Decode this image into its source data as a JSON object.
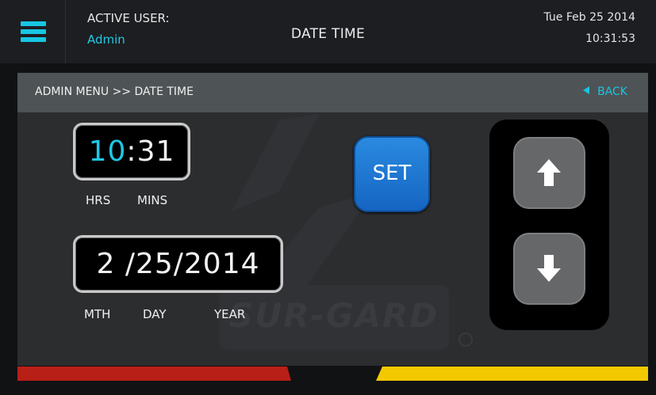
{
  "header": {
    "active_user_label": "ACTIVE USER:",
    "active_user_value": "Admin",
    "title": "DATE TIME",
    "date": "Tue Feb 25 2014",
    "time": "10:31:53"
  },
  "panel": {
    "breadcrumb": "ADMIN MENU >> DATE TIME",
    "back_label": "BACK"
  },
  "time_entry": {
    "hours": "10",
    "separator": ":",
    "minutes": "31",
    "hrs_label": "HRS",
    "mins_label": "MINS"
  },
  "date_entry": {
    "month": "2",
    "day": "25",
    "year": "2014",
    "mth_label": "MTH",
    "day_label": "DAY",
    "year_label": "YEAR"
  },
  "set_label": "SET",
  "watermark": "SUR-GARD",
  "icons": {
    "menu": "hamburger-menu-icon",
    "back": "left-triangle-icon",
    "up": "up-arrow-icon",
    "down": "down-arrow-icon"
  },
  "colors": {
    "accent": "#19c5e2",
    "set_button": "#1e79d6",
    "stripe_left": "#b81f16",
    "stripe_right": "#f2c800"
  }
}
